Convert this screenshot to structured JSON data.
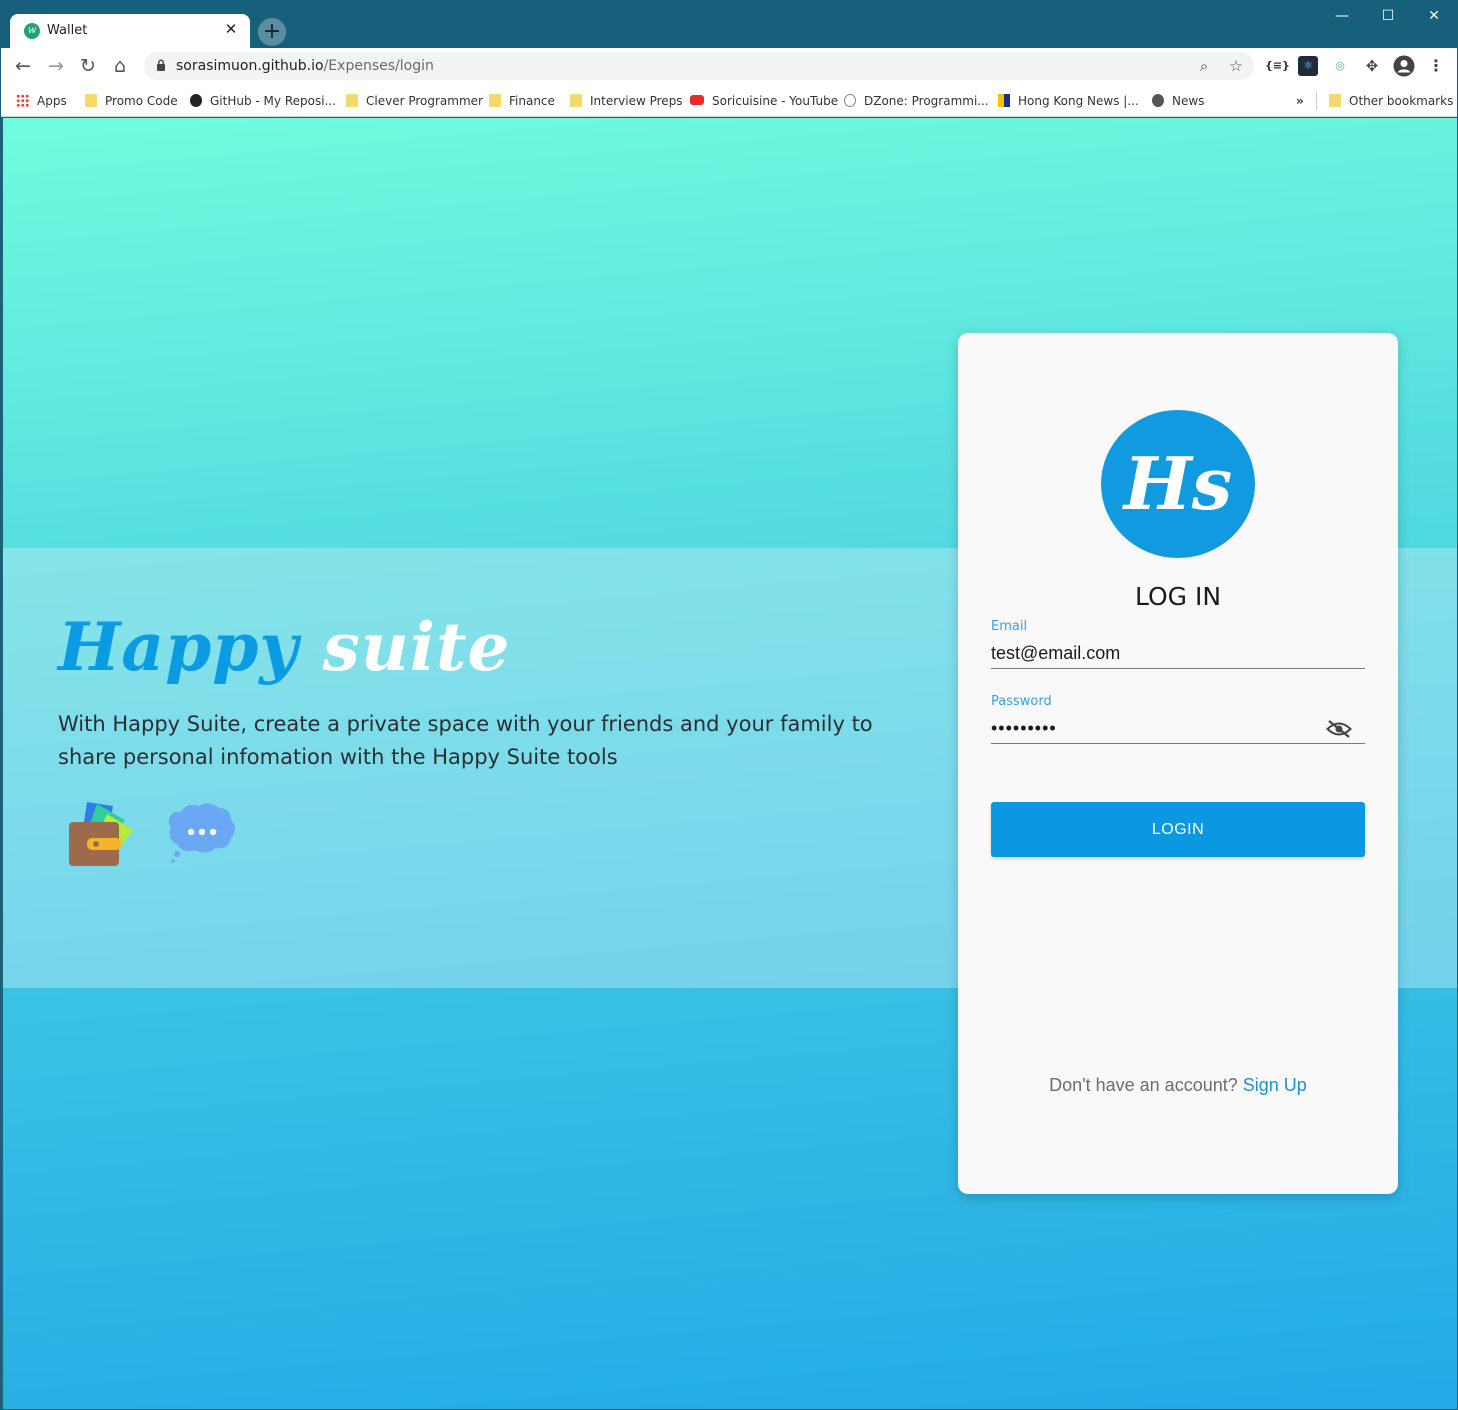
{
  "browser": {
    "tab_title": "Wallet",
    "tab_close": "✕",
    "new_tab": "+",
    "url_host": "sorasimuon.github.io",
    "url_path": "/Expenses/login",
    "window_controls": {
      "minimize": "—",
      "maximize": "☐",
      "close": "✕"
    }
  },
  "bookmarks": {
    "items": [
      {
        "label": "Apps",
        "icon": "apps-grid-icon"
      },
      {
        "label": "Promo Code",
        "icon": "folder-icon"
      },
      {
        "label": "GitHub - My Reposi...",
        "icon": "github-icon"
      },
      {
        "label": "Clever Programmer",
        "icon": "folder-icon"
      },
      {
        "label": "Finance",
        "icon": "folder-icon"
      },
      {
        "label": "Interview Preps",
        "icon": "folder-icon"
      },
      {
        "label": "Soricuisine - YouTube",
        "icon": "youtube-icon"
      },
      {
        "label": "DZone: Programmi...",
        "icon": "dzone-icon"
      },
      {
        "label": "Hong Kong News |...",
        "icon": "flag-icon"
      },
      {
        "label": "News",
        "icon": "globe-icon"
      }
    ],
    "overflow": "»",
    "other": "Other bookmarks"
  },
  "hero": {
    "title_first": "Happy",
    "title_second": "suite",
    "description": "With Happy Suite, create a private space with your friends and your family to share personal infomation with the Happy Suite tools"
  },
  "login": {
    "logo_text": "Hs",
    "title": "LOG IN",
    "email_label": "Email",
    "email_value": "test@email.com",
    "password_label": "Password",
    "password_value": "password1",
    "button": "LOGIN",
    "signup_prompt": "Don't have an account?",
    "signup_link": "Sign Up"
  },
  "colors": {
    "accent": "#0b98e3",
    "chrome": "#17607c",
    "background_top": "#71fbde",
    "background_bottom": "#22a9e6"
  }
}
